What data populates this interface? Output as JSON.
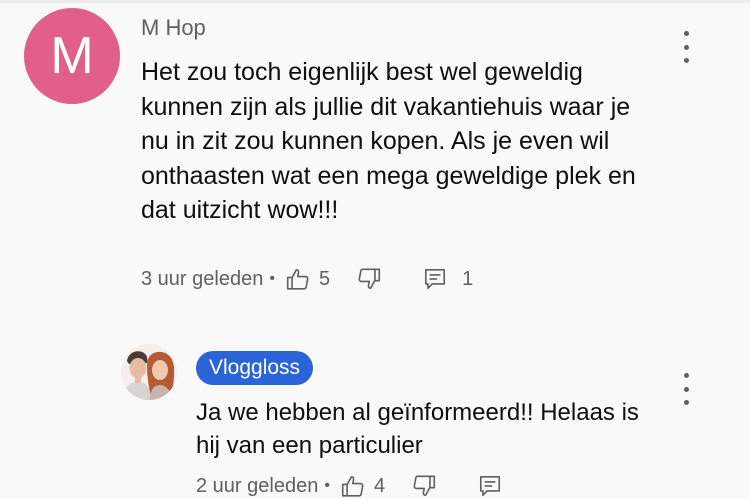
{
  "comment": {
    "author": "M Hop",
    "avatar_letter": "M",
    "avatar_color": "#e0608a",
    "text": "Het zou toch eigenlijk best wel geweldig kunnen zijn als jullie dit vakantiehuis waar je nu in zit zou kunnen kopen. Als je even wil onthaasten wat een mega geweldige plek en dat uitzicht wow!!!",
    "timestamp": "3 uur geleden",
    "separator": "•",
    "likes": "5",
    "replies": "1",
    "icons": [
      "thumbs-up-icon",
      "thumbs-down-icon",
      "comment-icon",
      "more-vertical-icon"
    ]
  },
  "reply": {
    "author_badge": "Vloggloss",
    "badge_color": "#2b64d6",
    "text": "Ja we hebben al geïnformeerd!! Helaas is hij van een particulier",
    "timestamp": "2 uur geleden",
    "separator": "•",
    "likes": "4",
    "icons": [
      "thumbs-up-icon",
      "thumbs-down-icon",
      "comment-icon",
      "more-vertical-icon"
    ]
  }
}
